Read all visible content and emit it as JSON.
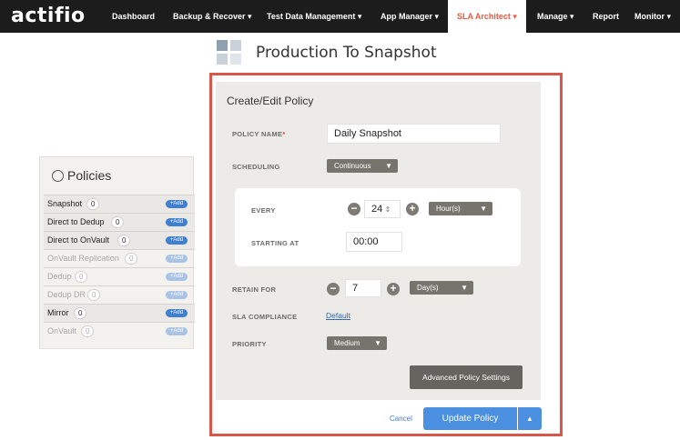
{
  "brand": "actifio",
  "nav": [
    {
      "label": "Dashboard"
    },
    {
      "label": "Backup & Recover ▾"
    },
    {
      "label": "Test Data Management ▾"
    },
    {
      "label": "App Manager ▾"
    },
    {
      "label": "SLA Architect ▾",
      "active": true
    },
    {
      "label": "Manage ▾"
    },
    {
      "label": "Report"
    },
    {
      "label": "Monitor ▾"
    }
  ],
  "page_title": "Production To Snapshot",
  "policies": {
    "title": "Policies",
    "add_label": "+Add",
    "items": [
      {
        "label": "Snapshot",
        "count": "0",
        "state": "active"
      },
      {
        "label": "Direct to Dedup",
        "count": "0",
        "state": "active"
      },
      {
        "label": "Direct to OnVault",
        "count": "0",
        "state": "active"
      },
      {
        "label": "OnVault Replication",
        "count": "0",
        "state": "disabled"
      },
      {
        "label": "Dedup",
        "count": "0",
        "state": "disabled"
      },
      {
        "label": "Dedup DR",
        "count": "0",
        "state": "disabled"
      },
      {
        "label": "Mirror",
        "count": "0",
        "state": "active"
      },
      {
        "label": "OnVault",
        "count": "0",
        "state": "disabled"
      }
    ]
  },
  "form": {
    "title": "Create/Edit Policy",
    "policy_name_label": "POLICY NAME",
    "policy_name_required": "*",
    "policy_name_value": "Daily Snapshot",
    "scheduling_label": "SCHEDULING",
    "scheduling_value": "Continuous",
    "every_label": "EVERY",
    "every_value": "24",
    "every_unit": "Hour(s)",
    "starting_at_label": "STARTING AT",
    "starting_at_value": "00:00",
    "retain_label": "RETAIN FOR",
    "retain_value": "7",
    "retain_unit": "Day(s)",
    "sla_compliance_label": "SLA COMPLIANCE",
    "sla_compliance_value": "Default",
    "priority_label": "PRIORITY",
    "priority_value": "Medium",
    "advanced_label": "Advanced Policy Settings",
    "cancel_label": "Cancel",
    "update_label": "Update Policy"
  },
  "colors": {
    "nav_bg": "#1c1c1c",
    "accent": "#e8573e",
    "highlight_frame": "#d9564a",
    "primary_button": "#4a8fe0"
  }
}
